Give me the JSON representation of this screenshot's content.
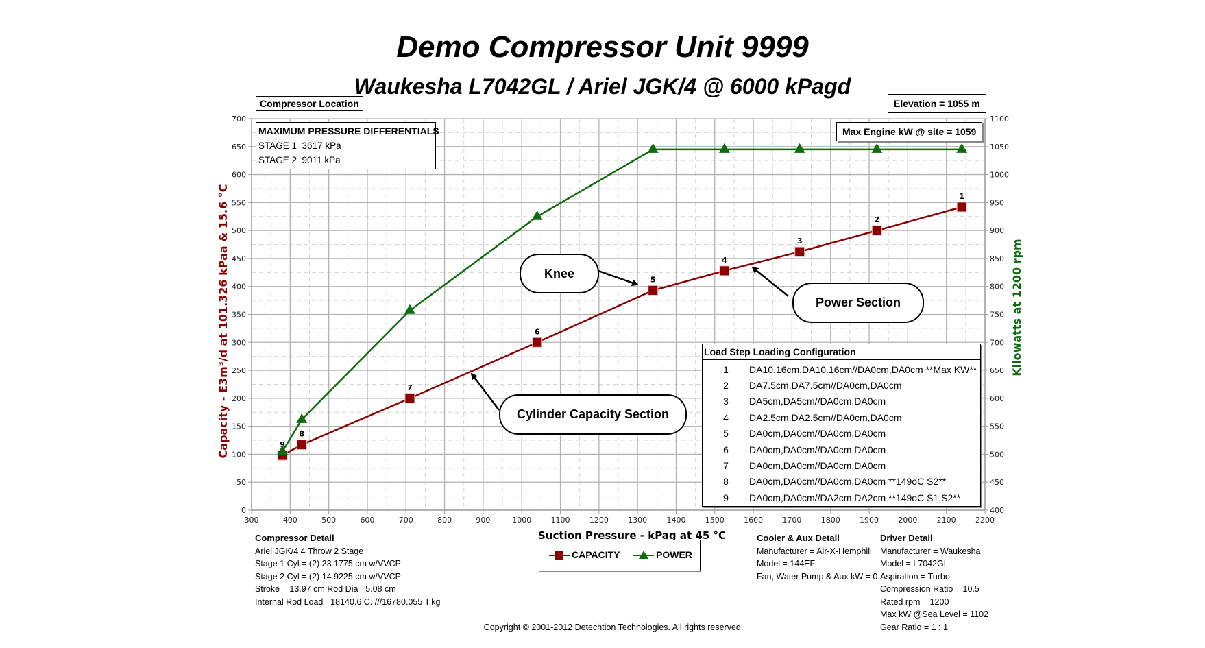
{
  "header": {
    "title": "Demo  Compressor Unit  9999",
    "subtitle": "Waukesha L7042GL / Ariel JGK/4 @ 6000 kPagd"
  },
  "boxes": {
    "compressor_location": "Compressor Location",
    "elevation": "Elevation = 1055 m",
    "max_engine_kw": "Max Engine kW @ site = 1059"
  },
  "max_pressure_differentials": {
    "title": "MAXIMUM PRESSURE DIFFERENTIALS",
    "rows": [
      {
        "label": "STAGE 1",
        "value": "3617 kPa"
      },
      {
        "label": "STAGE 2",
        "value": "9011 kPa"
      }
    ]
  },
  "annotations": {
    "knee": "Knee",
    "power_section": "Power Section",
    "cylinder_capacity_section": "Cylinder Capacity Section"
  },
  "load_table": {
    "headers": [
      "Load Step",
      "Loading Configuration"
    ],
    "rows": [
      {
        "step": "1",
        "config": "DA10.16cm,DA10.16cm//DA0cm,DA0cm **Max KW**"
      },
      {
        "step": "2",
        "config": "DA7.5cm,DA7.5cm//DA0cm,DA0cm"
      },
      {
        "step": "3",
        "config": "DA5cm,DA5cm//DA0cm,DA0cm"
      },
      {
        "step": "4",
        "config": "DA2.5cm,DA2.5cm//DA0cm,DA0cm"
      },
      {
        "step": "5",
        "config": "DA0cm,DA0cm//DA0cm,DA0cm"
      },
      {
        "step": "6",
        "config": "DA0cm,DA0cm//DA0cm,DA0cm"
      },
      {
        "step": "7",
        "config": "DA0cm,DA0cm//DA0cm,DA0cm"
      },
      {
        "step": "8",
        "config": "DA0cm,DA0cm//DA0cm,DA0cm **149oC S2**"
      },
      {
        "step": "9",
        "config": "DA0cm,DA0cm//DA2cm,DA2cm **149oC S1,S2**"
      }
    ]
  },
  "compressor_detail": {
    "title": "Compressor Detail",
    "lines": [
      "Ariel JGK/4   4 Throw  2 Stage",
      "Stage 1 Cyl = (2) 23.1775 cm w/VVCP",
      "Stage 2 Cyl = (2) 14.9225 cm w/VVCP",
      "Stroke = 13.97 cm Rod Dia= 5.08 cm",
      "Internal Rod Load= 18140.6 C. ///16780.055 T.kg"
    ]
  },
  "cooler_detail": {
    "title": "Cooler & Aux Detail",
    "lines": [
      "Manufacturer = Air-X-Hemphill",
      "Model = 144EF",
      "Fan, Water Pump & Aux kW = 0"
    ]
  },
  "driver_detail": {
    "title": "Driver Detail",
    "lines": [
      "Manufacturer = Waukesha",
      "Model = L7042GL",
      "Aspiration = Turbo",
      "Compression Ratio = 10.5",
      "Rated rpm = 1200",
      "Max kW @Sea Level = 1102",
      "Gear Ratio = 1 : 1"
    ]
  },
  "copyright": "Copyright © 2001-2012 Detechtion Technologies. All rights reserved.",
  "chart_data": {
    "type": "line",
    "title": "Demo  Compressor Unit  9999",
    "xlabel": "Suction Pressure - kPag at 45 °C",
    "ylabel": "Capacity - E3m³/d at 101.326 kPaa & 15.6 °C",
    "y2label": "Kilowatts at 1200 rpm",
    "xlim": [
      300,
      2200
    ],
    "ylim": [
      0,
      700
    ],
    "y2lim": [
      400,
      1100
    ],
    "xticks": [
      300,
      400,
      500,
      600,
      700,
      800,
      900,
      1000,
      1100,
      1200,
      1300,
      1400,
      1500,
      1600,
      1700,
      1800,
      1900,
      2000,
      2100,
      2200
    ],
    "yticks": [
      0,
      50,
      100,
      150,
      200,
      250,
      300,
      350,
      400,
      450,
      500,
      550,
      600,
      650,
      700
    ],
    "y2ticks": [
      400,
      450,
      500,
      550,
      600,
      650,
      700,
      750,
      800,
      850,
      900,
      950,
      1000,
      1050,
      1100
    ],
    "grid": true,
    "legend_position": "bottom-center",
    "series": [
      {
        "name": "CAPACITY",
        "axis": "left",
        "color": "#8b0000",
        "marker": "square",
        "points": [
          {
            "label": "9",
            "x": 380,
            "y": 98
          },
          {
            "label": "8",
            "x": 430,
            "y": 117
          },
          {
            "label": "7",
            "x": 710,
            "y": 200
          },
          {
            "label": "6",
            "x": 1040,
            "y": 300
          },
          {
            "label": "5",
            "x": 1340,
            "y": 393
          },
          {
            "label": "4",
            "x": 1525,
            "y": 428
          },
          {
            "label": "3",
            "x": 1720,
            "y": 462
          },
          {
            "label": "2",
            "x": 1920,
            "y": 500
          },
          {
            "label": "1",
            "x": 2140,
            "y": 542
          }
        ]
      },
      {
        "name": "POWER",
        "axis": "right",
        "color": "#0e6b0e",
        "marker": "triangle",
        "points": [
          {
            "x": 380,
            "y": 505
          },
          {
            "x": 430,
            "y": 562
          },
          {
            "x": 710,
            "y": 757
          },
          {
            "x": 1040,
            "y": 925
          },
          {
            "x": 1340,
            "y": 1045
          },
          {
            "x": 1525,
            "y": 1045
          },
          {
            "x": 1720,
            "y": 1045
          },
          {
            "x": 1920,
            "y": 1045
          },
          {
            "x": 2140,
            "y": 1045
          }
        ]
      }
    ]
  }
}
